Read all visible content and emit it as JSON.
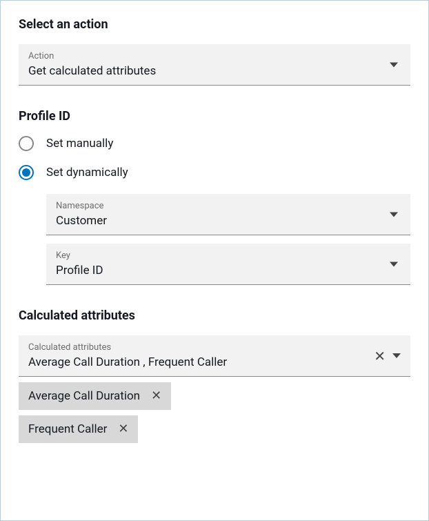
{
  "section1": {
    "title": "Select an action",
    "action": {
      "label": "Action",
      "value": "Get calculated attributes"
    }
  },
  "section2": {
    "title": "Profile ID",
    "radio": {
      "manual": "Set manually",
      "dynamic": "Set dynamically"
    },
    "namespace": {
      "label": "Namespace",
      "value": "Customer"
    },
    "key": {
      "label": "Key",
      "value": "Profile ID"
    }
  },
  "section3": {
    "title": "Calculated attributes",
    "multi": {
      "label": "Calculated attributes",
      "value": "Average Call Duration , Frequent Caller"
    },
    "chips": {
      "0": "Average Call Duration",
      "1": "Frequent Caller"
    }
  }
}
